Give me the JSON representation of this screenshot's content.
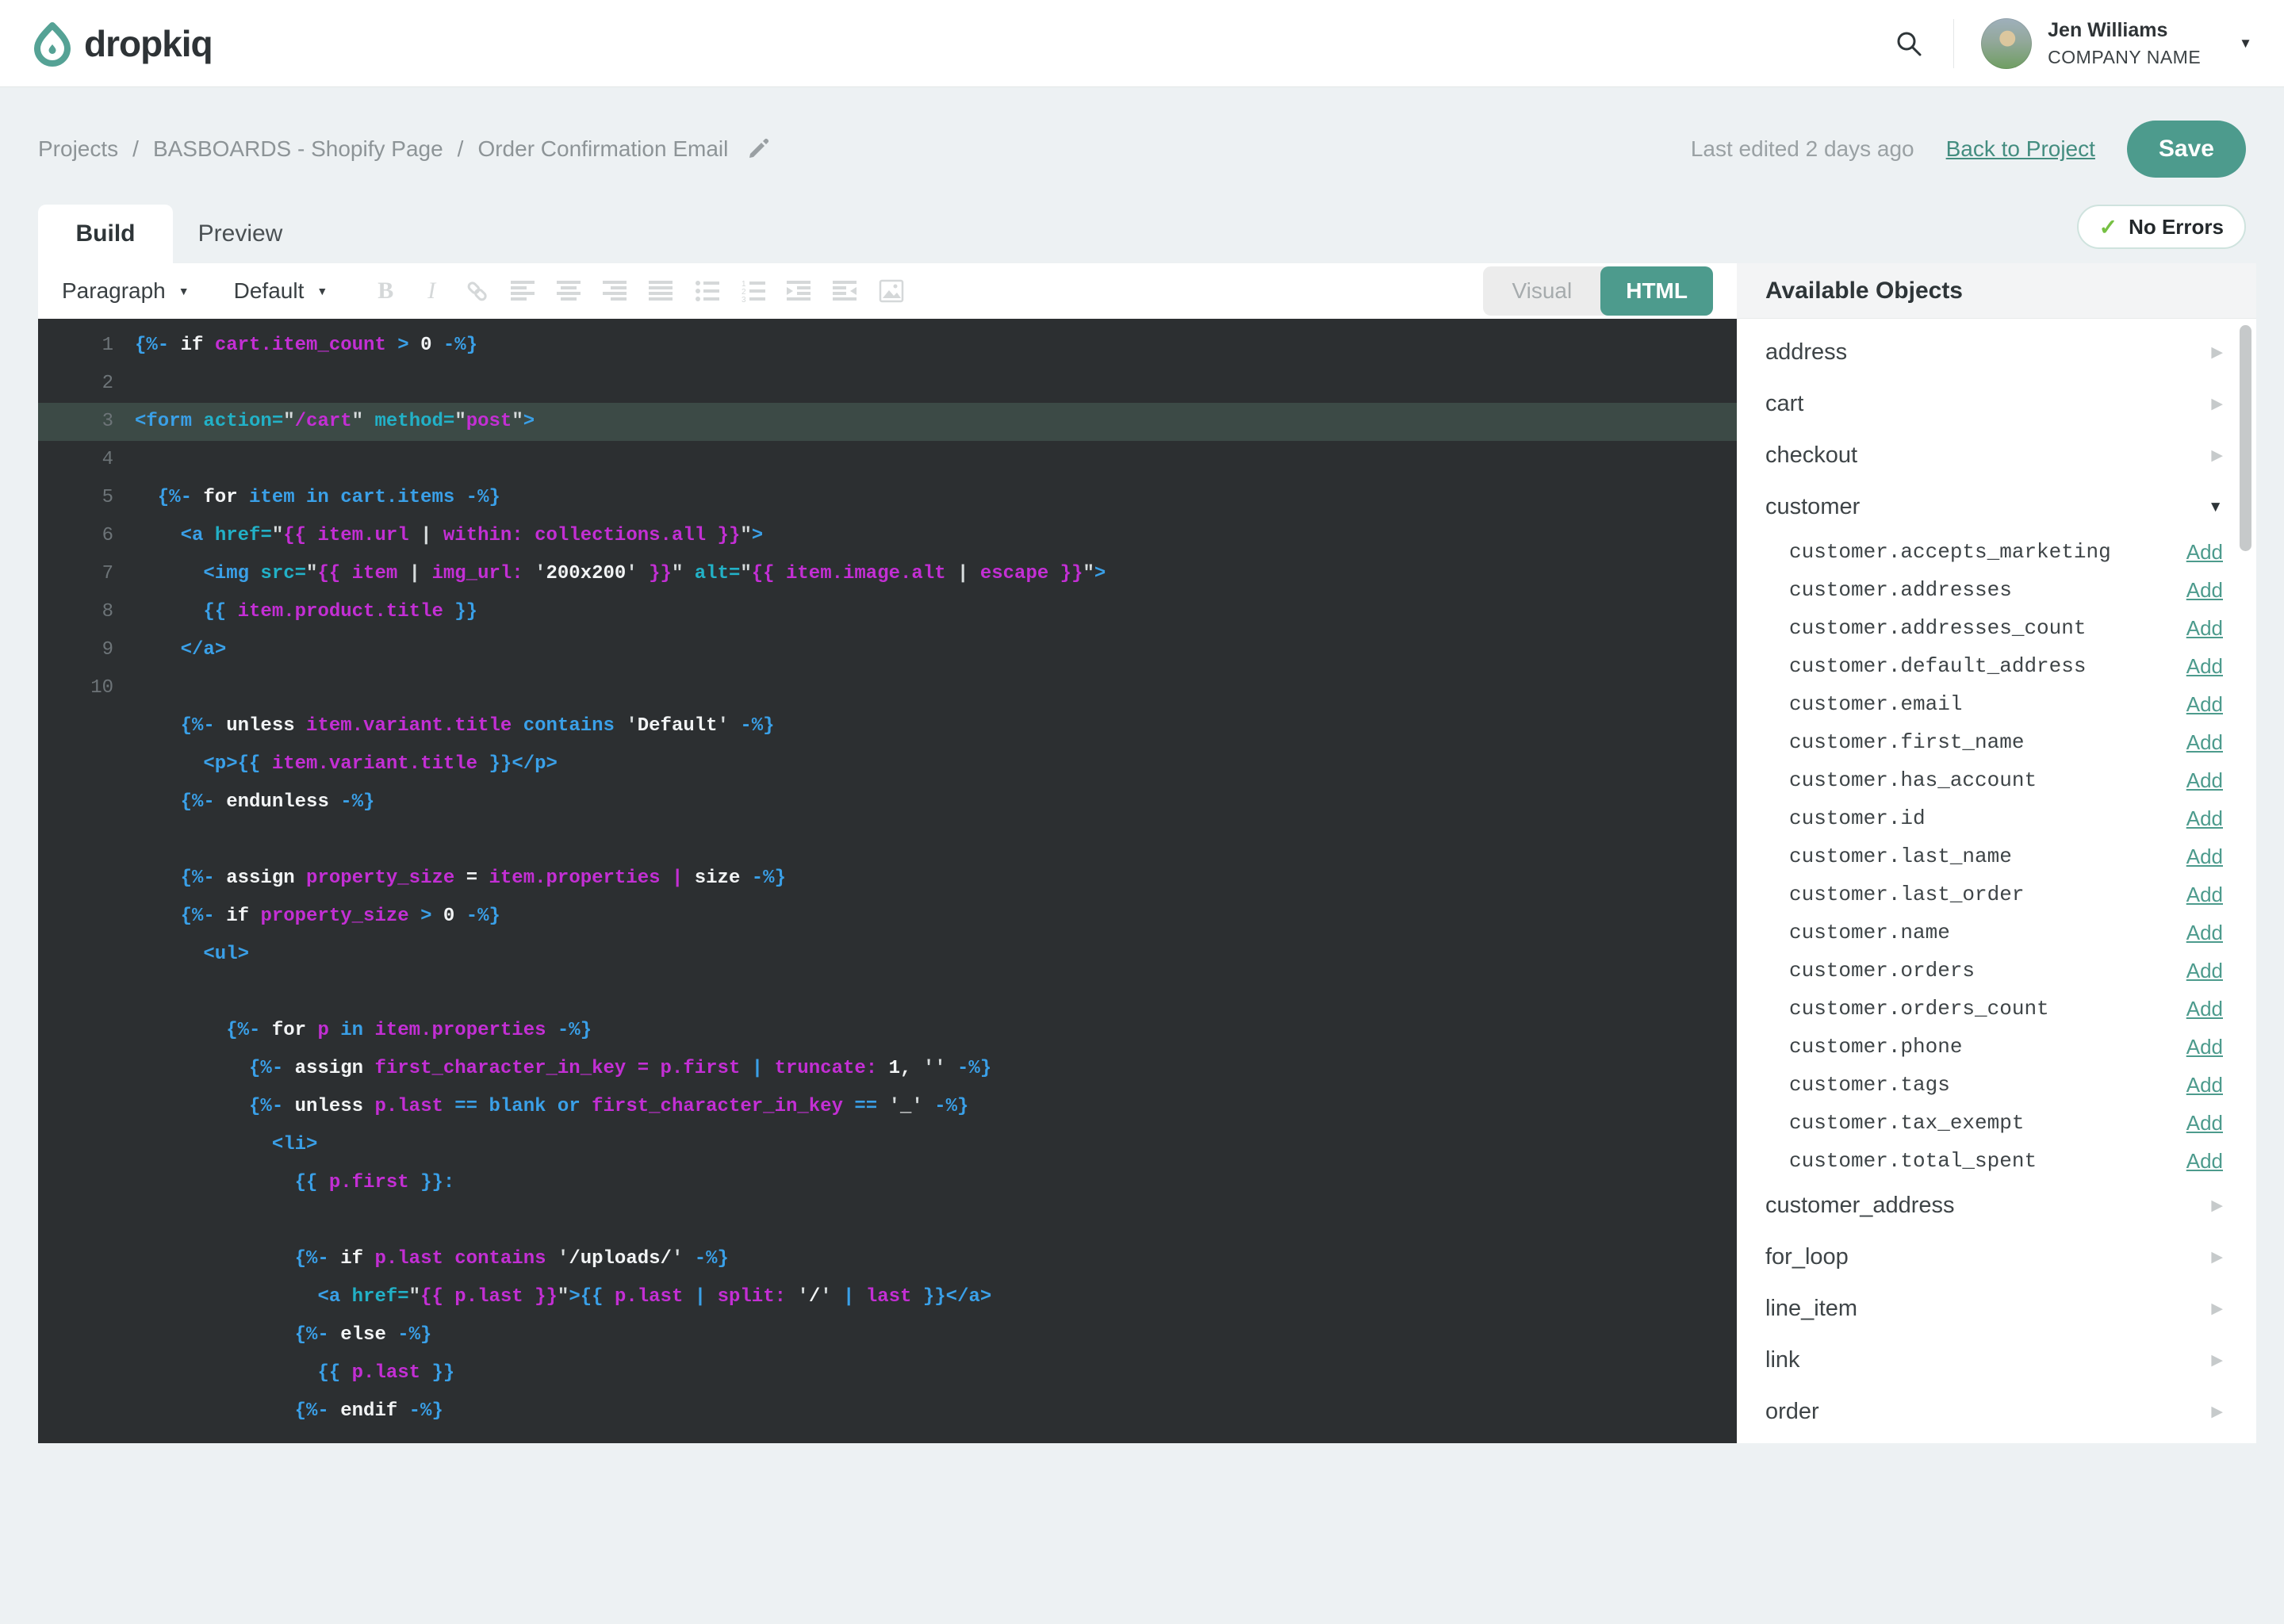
{
  "brand": {
    "name": "dropkiq"
  },
  "header": {
    "user_name": "Jen Williams",
    "company": "COMPANY NAME"
  },
  "breadcrumb": {
    "items": [
      "Projects",
      "BASBOARDS - Shopify Page",
      "Order Confirmation Email"
    ],
    "separator": "/"
  },
  "meta": {
    "last_edited": "Last edited 2 days ago",
    "back_link": "Back to Project",
    "save_label": "Save",
    "no_errors": "No Errors"
  },
  "tabs": {
    "build": "Build",
    "preview": "Preview"
  },
  "toolbar": {
    "paragraph": "Paragraph",
    "style": "Default",
    "icons": [
      "bold",
      "italic",
      "link",
      "align-left",
      "align-center",
      "align-right",
      "align-justify",
      "bullet-list",
      "numbered-list",
      "indent",
      "outdent",
      "image"
    ],
    "visual": "Visual",
    "html": "HTML"
  },
  "editor": {
    "lines": [
      {
        "num": "1",
        "ind": 0,
        "seg": [
          [
            "{%- ",
            "b"
          ],
          [
            "if ",
            "w"
          ],
          [
            "cart.item_count ",
            "m"
          ],
          [
            "> ",
            "b"
          ],
          [
            "0 ",
            "w"
          ],
          [
            "-%}",
            "b"
          ]
        ]
      },
      {
        "num": "2",
        "ind": 0,
        "seg": []
      },
      {
        "num": "3",
        "ind": 0,
        "hl": true,
        "seg": [
          [
            "<form ",
            "b"
          ],
          [
            "action=",
            "c"
          ],
          [
            "\"",
            "q"
          ],
          [
            "/cart",
            "m"
          ],
          [
            "\" ",
            "q"
          ],
          [
            "method=",
            "c"
          ],
          [
            "\"",
            "q"
          ],
          [
            "post",
            "m"
          ],
          [
            "\"",
            "q"
          ],
          [
            ">",
            "b"
          ]
        ]
      },
      {
        "num": "4",
        "ind": 0,
        "seg": []
      },
      {
        "num": "5",
        "ind": 2,
        "seg": [
          [
            "{%- ",
            "b"
          ],
          [
            "for ",
            "w"
          ],
          [
            "item in cart.items ",
            "b"
          ],
          [
            "-%}",
            "b"
          ]
        ]
      },
      {
        "num": "6",
        "ind": 4,
        "seg": [
          [
            "<a ",
            "b"
          ],
          [
            "href=",
            "c"
          ],
          [
            "\"",
            "q"
          ],
          [
            "{{ item.url ",
            "m"
          ],
          [
            "| ",
            "q"
          ],
          [
            "within: collections.all }}",
            "m"
          ],
          [
            "\"",
            "q"
          ],
          [
            ">",
            "b"
          ]
        ]
      },
      {
        "num": "7",
        "ind": 6,
        "seg": [
          [
            "<img ",
            "b"
          ],
          [
            "src=",
            "c"
          ],
          [
            "\"",
            "q"
          ],
          [
            "{{ item ",
            "m"
          ],
          [
            "| ",
            "q"
          ],
          [
            "img_url: ",
            "m"
          ],
          [
            "'",
            "q"
          ],
          [
            "200x200",
            "w"
          ],
          [
            "' ",
            "q"
          ],
          [
            "}}",
            "m"
          ],
          [
            "\" ",
            "q"
          ],
          [
            "alt=",
            "c"
          ],
          [
            "\"",
            "q"
          ],
          [
            "{{ item.image.alt ",
            "m"
          ],
          [
            "| ",
            "q"
          ],
          [
            "escape }}",
            "m"
          ],
          [
            "\"",
            "q"
          ],
          [
            ">",
            "b"
          ]
        ]
      },
      {
        "num": "8",
        "ind": 6,
        "seg": [
          [
            "{{ ",
            "b"
          ],
          [
            "item.product.title ",
            "m"
          ],
          [
            "}}",
            "b"
          ]
        ]
      },
      {
        "num": "9",
        "ind": 4,
        "seg": [
          [
            "</a>",
            "b"
          ]
        ]
      },
      {
        "num": "10",
        "ind": 0,
        "seg": []
      },
      {
        "ind": 4,
        "seg": [
          [
            "{%- ",
            "b"
          ],
          [
            "unless ",
            "w"
          ],
          [
            "item.variant.title ",
            "m"
          ],
          [
            "contains ",
            "b"
          ],
          [
            "'",
            "q"
          ],
          [
            "Default",
            "w"
          ],
          [
            "' ",
            "q"
          ],
          [
            "-%}",
            "b"
          ]
        ]
      },
      {
        "ind": 6,
        "seg": [
          [
            "<p>",
            "b"
          ],
          [
            "{{ ",
            "b"
          ],
          [
            "item.variant.title ",
            "m"
          ],
          [
            "}}",
            "b"
          ],
          [
            "</p>",
            "b"
          ]
        ]
      },
      {
        "ind": 4,
        "seg": [
          [
            "{%- ",
            "b"
          ],
          [
            "endunless ",
            "w"
          ],
          [
            "-%}",
            "b"
          ]
        ]
      },
      {
        "ind": 0,
        "seg": []
      },
      {
        "ind": 4,
        "seg": [
          [
            "{%- ",
            "b"
          ],
          [
            "assign ",
            "w"
          ],
          [
            "property_size ",
            "m"
          ],
          [
            "= ",
            "w"
          ],
          [
            "item.properties ",
            "m"
          ],
          [
            "| ",
            "m"
          ],
          [
            "size ",
            "w"
          ],
          [
            "-%}",
            "b"
          ]
        ]
      },
      {
        "ind": 4,
        "seg": [
          [
            "{%- ",
            "b"
          ],
          [
            "if ",
            "w"
          ],
          [
            "property_size ",
            "m"
          ],
          [
            "> ",
            "b"
          ],
          [
            "0 ",
            "w"
          ],
          [
            "-%}",
            "b"
          ]
        ]
      },
      {
        "ind": 6,
        "seg": [
          [
            "<ul>",
            "b"
          ]
        ]
      },
      {
        "ind": 0,
        "seg": []
      },
      {
        "ind": 8,
        "seg": [
          [
            "{%- ",
            "b"
          ],
          [
            "for ",
            "w"
          ],
          [
            "p ",
            "m"
          ],
          [
            "in ",
            "b"
          ],
          [
            "item.properties ",
            "m"
          ],
          [
            "-%}",
            "b"
          ]
        ]
      },
      {
        "ind": 10,
        "seg": [
          [
            "{%- ",
            "b"
          ],
          [
            "assign ",
            "w"
          ],
          [
            "first_character_in_key ",
            "m"
          ],
          [
            "= ",
            "m"
          ],
          [
            "p.first ",
            "m"
          ],
          [
            "| ",
            "b"
          ],
          [
            "truncate: ",
            "m"
          ],
          [
            "1, ",
            "w"
          ],
          [
            "'' ",
            "q"
          ],
          [
            "-%}",
            "b"
          ]
        ]
      },
      {
        "ind": 10,
        "seg": [
          [
            "{%- ",
            "b"
          ],
          [
            "unless ",
            "w"
          ],
          [
            "p.last ",
            "m"
          ],
          [
            "== ",
            "b"
          ],
          [
            "blank or ",
            "b"
          ],
          [
            "first_character_in_key ",
            "m"
          ],
          [
            "== ",
            "b"
          ],
          [
            "'",
            "q"
          ],
          [
            "_",
            "w"
          ],
          [
            "' ",
            "q"
          ],
          [
            "-%}",
            "b"
          ]
        ]
      },
      {
        "ind": 12,
        "seg": [
          [
            "<li>",
            "b"
          ]
        ]
      },
      {
        "ind": 14,
        "seg": [
          [
            "{{ ",
            "b"
          ],
          [
            "p.first ",
            "m"
          ],
          [
            "}}:",
            "b"
          ]
        ]
      },
      {
        "ind": 0,
        "seg": []
      },
      {
        "ind": 14,
        "seg": [
          [
            "{%- ",
            "b"
          ],
          [
            "if ",
            "w"
          ],
          [
            "p.last ",
            "m"
          ],
          [
            "contains ",
            "m"
          ],
          [
            "'",
            "q"
          ],
          [
            "/uploads/",
            "w"
          ],
          [
            "' ",
            "q"
          ],
          [
            "-%}",
            "b"
          ]
        ]
      },
      {
        "ind": 16,
        "seg": [
          [
            "<a ",
            "b"
          ],
          [
            "href=",
            "c"
          ],
          [
            "\"",
            "q"
          ],
          [
            "{{ p.last }}",
            "m"
          ],
          [
            "\"",
            "q"
          ],
          [
            ">",
            "b"
          ],
          [
            "{{ ",
            "b"
          ],
          [
            "p.last ",
            "m"
          ],
          [
            "| ",
            "b"
          ],
          [
            "split: ",
            "m"
          ],
          [
            "'",
            "q"
          ],
          [
            "/",
            "w"
          ],
          [
            "' ",
            "q"
          ],
          [
            "| ",
            "b"
          ],
          [
            "last ",
            "m"
          ],
          [
            "}}",
            "b"
          ],
          [
            "</a>",
            "b"
          ]
        ]
      },
      {
        "ind": 14,
        "seg": [
          [
            "{%- ",
            "b"
          ],
          [
            "else ",
            "w"
          ],
          [
            "-%}",
            "b"
          ]
        ]
      },
      {
        "ind": 16,
        "seg": [
          [
            "{{ ",
            "b"
          ],
          [
            "p.last ",
            "m"
          ],
          [
            "}}",
            "b"
          ]
        ]
      },
      {
        "ind": 14,
        "seg": [
          [
            "{%- ",
            "b"
          ],
          [
            "endif ",
            "w"
          ],
          [
            "-%}",
            "b"
          ]
        ]
      }
    ]
  },
  "panel": {
    "title": "Available Objects",
    "add_label": "Add",
    "groups": [
      {
        "label": "address",
        "state": "collapsed"
      },
      {
        "label": "cart",
        "state": "collapsed"
      },
      {
        "label": "checkout",
        "state": "collapsed"
      },
      {
        "label": "customer",
        "state": "expanded",
        "children": [
          "customer.accepts_marketing",
          "customer.addresses",
          "customer.addresses_count",
          "customer.default_address",
          "customer.email",
          "customer.first_name",
          "customer.has_account",
          "customer.id",
          "customer.last_name",
          "customer.last_order",
          "customer.name",
          "customer.orders",
          "customer.orders_count",
          "customer.phone",
          "customer.tags",
          "customer.tax_exempt",
          "customer.total_spent"
        ]
      },
      {
        "label": "customer_address",
        "state": "collapsed"
      },
      {
        "label": "for_loop",
        "state": "collapsed"
      },
      {
        "label": "line_item",
        "state": "collapsed"
      },
      {
        "label": "link",
        "state": "collapsed"
      },
      {
        "label": "order",
        "state": "collapsed"
      }
    ]
  },
  "colors": {
    "accent": "#4d9b8d",
    "green": "#76c043",
    "page-bg": "#edf1f3",
    "ed-bg": "#2c2f31",
    "ed-hl": "#3c4a46",
    "gutter": "#6d7478",
    "tok-b": "#3aa0e8",
    "tok-c": "#22b1c7",
    "tok-m": "#c32fd4",
    "tok-w": "#f2f4f5",
    "tok-q": "#d6dbdc"
  }
}
